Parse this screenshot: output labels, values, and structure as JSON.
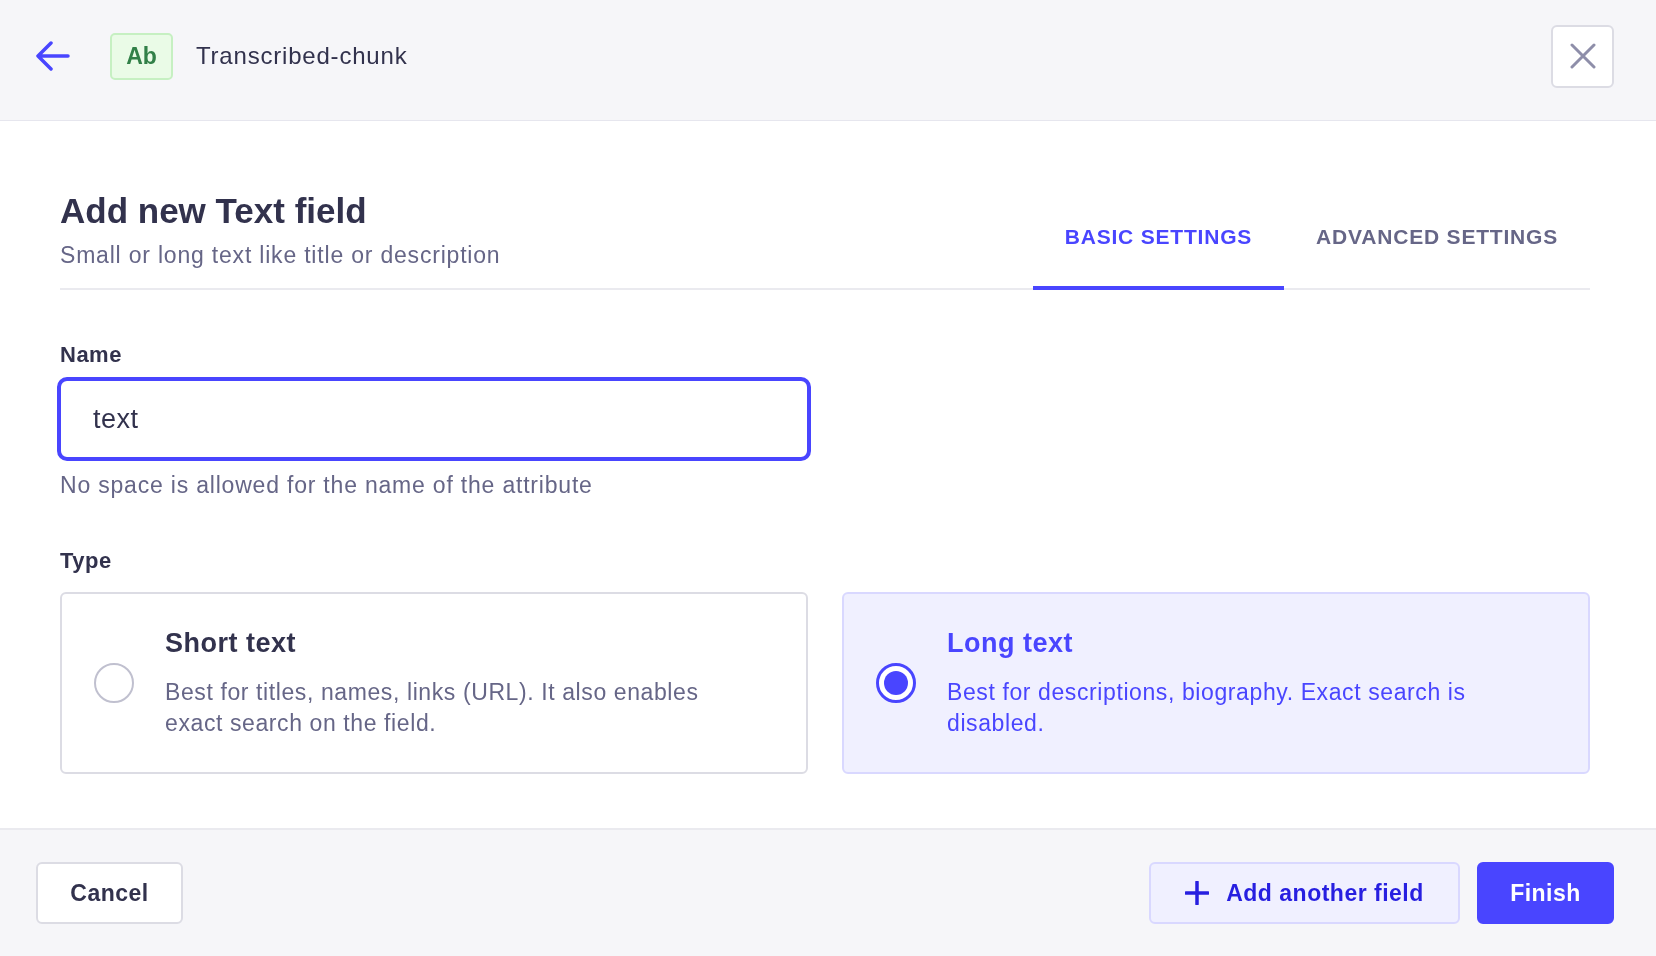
{
  "header": {
    "badge": "Ab",
    "title": "Transcribed-chunk"
  },
  "form": {
    "title": "Add new Text field",
    "subtitle": "Small or long text like title or description"
  },
  "tabs": [
    {
      "label": "BASIC SETTINGS",
      "selected": true
    },
    {
      "label": "ADVANCED SETTINGS",
      "selected": false
    }
  ],
  "name_field": {
    "label": "Name",
    "value": "text",
    "focused": true,
    "hint": "No space is allowed for the name of the attribute"
  },
  "type": {
    "label": "Type",
    "options": [
      {
        "title": "Short text",
        "description": "Best for titles, names, links (URL). It also enables exact search on the field.",
        "selected": false
      },
      {
        "title": "Long text",
        "description": "Best for descriptions, biography. Exact search is disabled.",
        "selected": true
      }
    ]
  },
  "footer": {
    "buttons": [
      {
        "label": "Cancel",
        "kind": "secondary"
      },
      {
        "label": "Add another field",
        "kind": "tertiary"
      },
      {
        "label": "Finish",
        "kind": "primary"
      }
    ]
  }
}
